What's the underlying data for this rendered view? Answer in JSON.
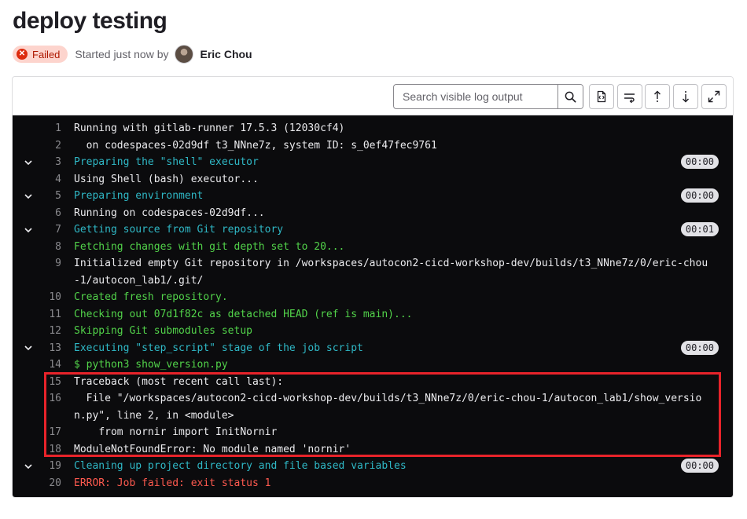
{
  "page": {
    "title": "deploy testing"
  },
  "status": {
    "badge": "Failed",
    "started_text": "Started just now by",
    "author": "Eric Chou"
  },
  "toolbar": {
    "search_placeholder": "Search visible log output",
    "buttons": [
      "search-icon",
      "raw-file-icon",
      "wrap-lines-icon",
      "scroll-top-icon",
      "scroll-bottom-icon",
      "fullscreen-icon"
    ]
  },
  "colors": {
    "log_bg": "#0b0b0d",
    "section_header": "#2fb8c6",
    "success": "#52d34a",
    "error": "#ff5a4f",
    "highlight": "#e8232a",
    "badge_bg": "#fdd4cd",
    "badge_icon": "#dd2b0e"
  },
  "log": {
    "lines": [
      {
        "num": "1",
        "text": "Running with gitlab-runner 17.5.3 (12030cf4)"
      },
      {
        "num": "2",
        "text": "  on codespaces-02d9df t3_NNne7z, system ID: s_0ef47fec9761"
      },
      {
        "num": "3",
        "text": "Preparing the \"shell\" executor",
        "duration": "00:00"
      },
      {
        "num": "4",
        "text": "Using Shell (bash) executor..."
      },
      {
        "num": "5",
        "text": "Preparing environment",
        "duration": "00:00"
      },
      {
        "num": "6",
        "text": "Running on codespaces-02d9df..."
      },
      {
        "num": "7",
        "text": "Getting source from Git repository",
        "duration": "00:01"
      },
      {
        "num": "8",
        "text": "Fetching changes with git depth set to 20..."
      },
      {
        "num": "9",
        "text": "Initialized empty Git repository in /workspaces/autocon2-cicd-workshop-dev/builds/t3_NNne7z/0/eric-chou-1/autocon_lab1/.git/"
      },
      {
        "num": "10",
        "text": "Created fresh repository."
      },
      {
        "num": "11",
        "text": "Checking out 07d1f82c as detached HEAD (ref is main)..."
      },
      {
        "num": "12",
        "text": "Skipping Git submodules setup"
      },
      {
        "num": "13",
        "text": "Executing \"step_script\" stage of the job script",
        "duration": "00:00"
      },
      {
        "num": "14",
        "text": "$ python3 show_version.py"
      },
      {
        "num": "15",
        "text": "Traceback (most recent call last):"
      },
      {
        "num": "16",
        "text": "  File \"/workspaces/autocon2-cicd-workshop-dev/builds/t3_NNne7z/0/eric-chou-1/autocon_lab1/show_version.py\", line 2, in <module>"
      },
      {
        "num": "17",
        "text": "    from nornir import InitNornir"
      },
      {
        "num": "18",
        "text": "ModuleNotFoundError: No module named 'nornir'"
      },
      {
        "num": "19",
        "text": "Cleaning up project directory and file based variables",
        "duration": "00:00"
      },
      {
        "num": "20",
        "text": "ERROR: Job failed: exit status 1"
      }
    ]
  }
}
